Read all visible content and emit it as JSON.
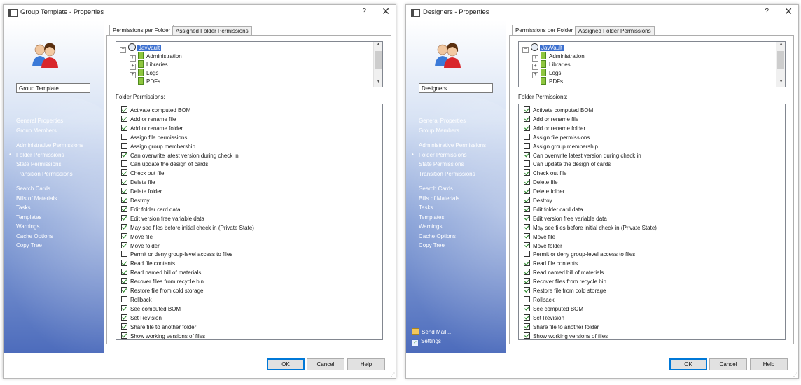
{
  "dialogs": [
    {
      "title": "Group Template - Properties",
      "help_label": "?",
      "close_label": "✕",
      "group_name": "Group Template",
      "nav_groups": [
        [
          "General Properties",
          "Group Members"
        ],
        [
          "Administrative Permissions",
          "Folder Permissions",
          "State Permissions",
          "Transition Permissions"
        ],
        [
          "Search Cards",
          "Bills of Materials",
          "Tasks",
          "Templates",
          "Warnings",
          "Cache Options",
          "Copy Tree"
        ]
      ],
      "active_nav": "Folder Permissions",
      "footer": [],
      "tabs": [
        "Permissions per Folder",
        "Assigned Folder Permissions"
      ],
      "tree": {
        "root": "JavVault",
        "children": [
          "Administration",
          "Libraries",
          "Logs",
          "PDFs"
        ]
      },
      "folder_permissions_label": "Folder Permissions:",
      "permissions": [
        {
          "label": "Activate computed BOM",
          "checked": true
        },
        {
          "label": "Add or rename file",
          "checked": true
        },
        {
          "label": "Add or rename folder",
          "checked": true
        },
        {
          "label": "Assign file permissions",
          "checked": false
        },
        {
          "label": "Assign group membership",
          "checked": false
        },
        {
          "label": "Can overwrite latest version during check in",
          "checked": true
        },
        {
          "label": "Can update the design of cards",
          "checked": false
        },
        {
          "label": "Check out file",
          "checked": true
        },
        {
          "label": "Delete file",
          "checked": true
        },
        {
          "label": "Delete folder",
          "checked": true
        },
        {
          "label": "Destroy",
          "checked": true
        },
        {
          "label": "Edit folder card data",
          "checked": true
        },
        {
          "label": "Edit version free variable data",
          "checked": true
        },
        {
          "label": "May see files before initial check in (Private State)",
          "checked": true
        },
        {
          "label": "Move file",
          "checked": true
        },
        {
          "label": "Move folder",
          "checked": true
        },
        {
          "label": "Permit or deny group-level access to files",
          "checked": false
        },
        {
          "label": "Read file contents",
          "checked": true
        },
        {
          "label": "Read named bill of materials",
          "checked": true
        },
        {
          "label": "Recover files from recycle bin",
          "checked": true
        },
        {
          "label": "Restore file from cold storage",
          "checked": true
        },
        {
          "label": "Rollback",
          "checked": false
        },
        {
          "label": "See computed BOM",
          "checked": true
        },
        {
          "label": "Set Revision",
          "checked": true
        },
        {
          "label": "Share file to another folder",
          "checked": true
        },
        {
          "label": "Show working versions of files",
          "checked": true
        }
      ],
      "buttons": {
        "ok": "OK",
        "cancel": "Cancel",
        "help": "Help"
      }
    },
    {
      "title": "Designers - Properties",
      "help_label": "?",
      "close_label": "✕",
      "group_name": "Designers",
      "nav_groups": [
        [
          "General Properties",
          "Group Members"
        ],
        [
          "Administrative Permissions",
          "Folder Permissions",
          "State Permissions",
          "Transition Permissions"
        ],
        [
          "Search Cards",
          "Bills of Materials",
          "Tasks",
          "Templates",
          "Warnings",
          "Cache Options",
          "Copy Tree"
        ]
      ],
      "active_nav": "Folder Permissions",
      "footer": [
        "Send Mail...",
        "Settings"
      ],
      "tabs": [
        "Permissions per Folder",
        "Assigned Folder Permissions"
      ],
      "tree": {
        "root": "JavVault",
        "children": [
          "Administration",
          "Libraries",
          "Logs",
          "PDFs"
        ]
      },
      "folder_permissions_label": "Folder Permissions:",
      "permissions": [
        {
          "label": "Activate computed BOM",
          "checked": true
        },
        {
          "label": "Add or rename file",
          "checked": true
        },
        {
          "label": "Add or rename folder",
          "checked": true
        },
        {
          "label": "Assign file permissions",
          "checked": false
        },
        {
          "label": "Assign group membership",
          "checked": false
        },
        {
          "label": "Can overwrite latest version during check in",
          "checked": true
        },
        {
          "label": "Can update the design of cards",
          "checked": false
        },
        {
          "label": "Check out file",
          "checked": true
        },
        {
          "label": "Delete file",
          "checked": true
        },
        {
          "label": "Delete folder",
          "checked": true
        },
        {
          "label": "Destroy",
          "checked": true
        },
        {
          "label": "Edit folder card data",
          "checked": true
        },
        {
          "label": "Edit version free variable data",
          "checked": true
        },
        {
          "label": "May see files before initial check in (Private State)",
          "checked": true
        },
        {
          "label": "Move file",
          "checked": true
        },
        {
          "label": "Move folder",
          "checked": true
        },
        {
          "label": "Permit or deny group-level access to files",
          "checked": false
        },
        {
          "label": "Read file contents",
          "checked": true
        },
        {
          "label": "Read named bill of materials",
          "checked": true
        },
        {
          "label": "Recover files from recycle bin",
          "checked": true
        },
        {
          "label": "Restore file from cold storage",
          "checked": true
        },
        {
          "label": "Rollback",
          "checked": false
        },
        {
          "label": "See computed BOM",
          "checked": true
        },
        {
          "label": "Set Revision",
          "checked": true
        },
        {
          "label": "Share file to another folder",
          "checked": true
        },
        {
          "label": "Show working versions of files",
          "checked": true
        }
      ],
      "buttons": {
        "ok": "OK",
        "cancel": "Cancel",
        "help": "Help"
      }
    }
  ]
}
